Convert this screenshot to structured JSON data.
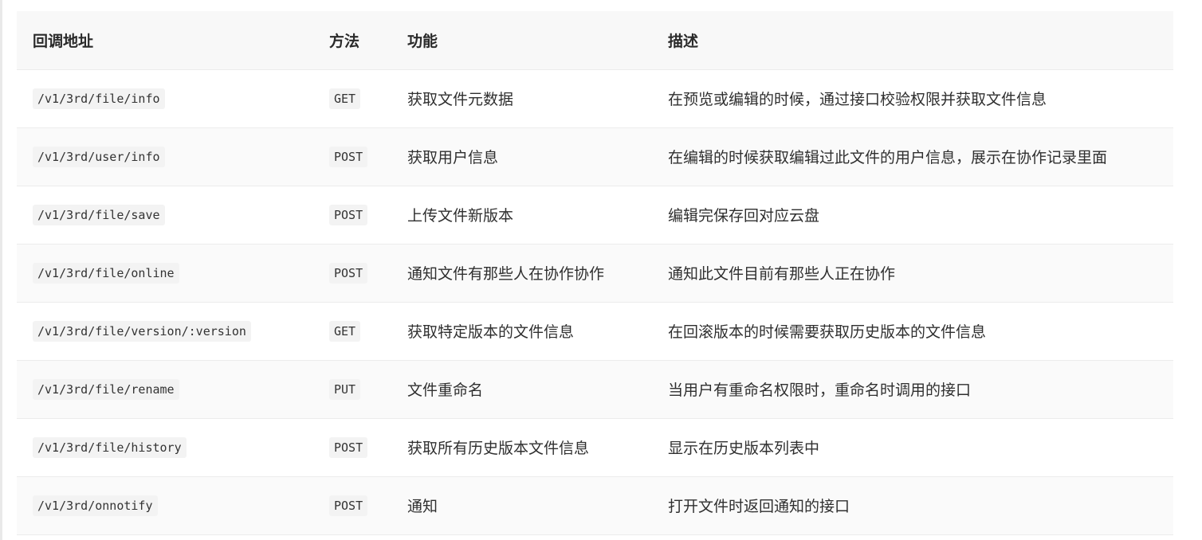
{
  "headers": {
    "url": "回调地址",
    "method": "方法",
    "function": "功能",
    "description": "描述"
  },
  "rows": [
    {
      "url": "/v1/3rd/file/info",
      "method": "GET",
      "function": "获取文件元数据",
      "description": "在预览或编辑的时候，通过接口校验权限并获取文件信息"
    },
    {
      "url": "/v1/3rd/user/info",
      "method": "POST",
      "function": "获取用户信息",
      "description": "在编辑的时候获取编辑过此文件的用户信息，展示在协作记录里面"
    },
    {
      "url": "/v1/3rd/file/save",
      "method": "POST",
      "function": "上传文件新版本",
      "description": "编辑完保存回对应云盘"
    },
    {
      "url": "/v1/3rd/file/online",
      "method": "POST",
      "function": "通知文件有那些人在协作协作",
      "description": "通知此文件目前有那些人正在协作"
    },
    {
      "url": "/v1/3rd/file/version/:version",
      "method": "GET",
      "function": "获取特定版本的文件信息",
      "description": "在回滚版本的时候需要获取历史版本的文件信息"
    },
    {
      "url": "/v1/3rd/file/rename",
      "method": "PUT",
      "function": "文件重命名",
      "description": "当用户有重命名权限时，重命名时调用的接口"
    },
    {
      "url": "/v1/3rd/file/history",
      "method": "POST",
      "function": "获取所有历史版本文件信息",
      "description": "显示在历史版本列表中"
    },
    {
      "url": "/v1/3rd/onnotify",
      "method": "POST",
      "function": "通知",
      "description": "打开文件时返回通知的接口"
    }
  ]
}
